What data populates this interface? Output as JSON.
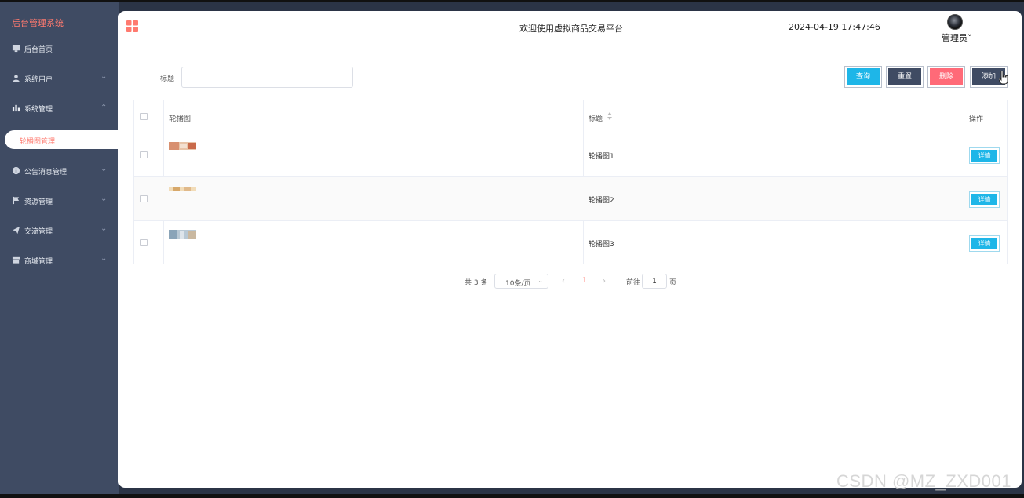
{
  "app": {
    "title": "后台管理系统"
  },
  "sidebar": {
    "items": [
      {
        "label": "后台首页",
        "icon": "monitor-icon",
        "expandable": false
      },
      {
        "label": "系统用户",
        "icon": "user-icon",
        "expandable": true,
        "expanded": false
      },
      {
        "label": "系统管理",
        "icon": "bar-chart-icon",
        "expandable": true,
        "expanded": true
      },
      {
        "label": "公告消息管理",
        "icon": "info-icon",
        "expandable": true,
        "expanded": false
      },
      {
        "label": "资源管理",
        "icon": "flag-icon",
        "expandable": true,
        "expanded": false
      },
      {
        "label": "交流管理",
        "icon": "send-icon",
        "expandable": true,
        "expanded": false
      },
      {
        "label": "商城管理",
        "icon": "store-icon",
        "expandable": true,
        "expanded": false
      }
    ],
    "active_sub_item": "轮播图管理"
  },
  "header": {
    "welcome": "欢迎使用虚拟商品交易平台",
    "datetime": "2024-04-19 17:47:46",
    "user": "管理员",
    "user_caret": "˅"
  },
  "search": {
    "label": "标题",
    "value": "",
    "placeholder": ""
  },
  "toolbar": {
    "query": "查询",
    "reset": "重置",
    "delete": "删除",
    "add": "添加"
  },
  "table": {
    "columns": [
      "轮播图",
      "标题",
      "操作"
    ],
    "rows": [
      {
        "title": "轮播图1",
        "action": "详情"
      },
      {
        "title": "轮播图2",
        "action": "详情"
      },
      {
        "title": "轮播图3",
        "action": "详情"
      }
    ]
  },
  "pagination": {
    "total": "共 3 条",
    "page_size": "10条/页",
    "current_page": "1",
    "goto_label": "前往",
    "goto_value": "1",
    "page_suffix": "页"
  },
  "watermark": "CSDN @MZ_ZXD001",
  "colors": {
    "sidebar_bg": "#3f4b63",
    "accent": "#ff7a6f",
    "primary_button": "#1eb6e8",
    "danger_button": "#ff6a78",
    "dark_button": "#3f4b63"
  }
}
